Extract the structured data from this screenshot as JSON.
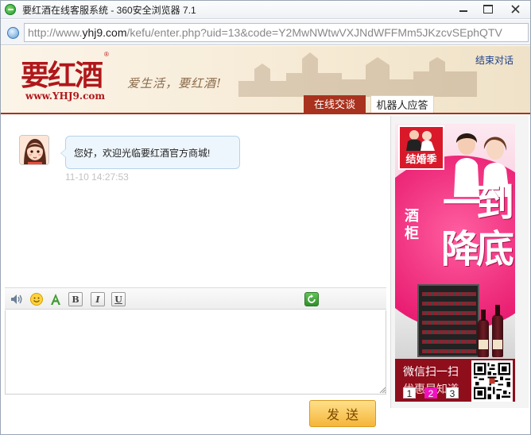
{
  "window": {
    "title": "要红酒在线客服系统 - 360安全浏览器 7.1",
    "min_icon": "minimize-icon",
    "max_icon": "maximize-icon",
    "close_icon": "close-icon"
  },
  "address": {
    "scheme": "http://www.",
    "domain": "yhj9.com",
    "path": "/kefu/enter.php?uid=13&code=Y2MwNWtwVXJNdWFFMm5JKzcvSEphQTV"
  },
  "header": {
    "logo": "要红酒",
    "logo_reg": "®",
    "logo_url": "www.YHJ9.com",
    "slogan": "爱生活，要红酒!",
    "end_chat": "结束对话",
    "tabs": [
      {
        "label": "在线交谈",
        "active": true
      },
      {
        "label": "机器人应答",
        "active": false
      }
    ]
  },
  "chat": {
    "messages": [
      {
        "text": "您好，欢迎光临要红酒官方商城!",
        "time": "11-10 14:27:53"
      }
    ]
  },
  "toolbar": {
    "bold": "B",
    "italic": "I",
    "underline": "U"
  },
  "input": {
    "value": ""
  },
  "send_label": "发送",
  "ad": {
    "badge": "结婚季",
    "big1": "一到",
    "big2": "降底",
    "small": "酒柜",
    "qr_line1": "微信扫一扫",
    "qr_line2": "优惠早知道",
    "pages": [
      "1",
      "2",
      "3"
    ],
    "active_page": 2
  },
  "colors": {
    "brand_red": "#a8321e",
    "send_yellow": "#f5b53a",
    "ad_pink": "#e91e72",
    "pager_active": "#f012be"
  }
}
